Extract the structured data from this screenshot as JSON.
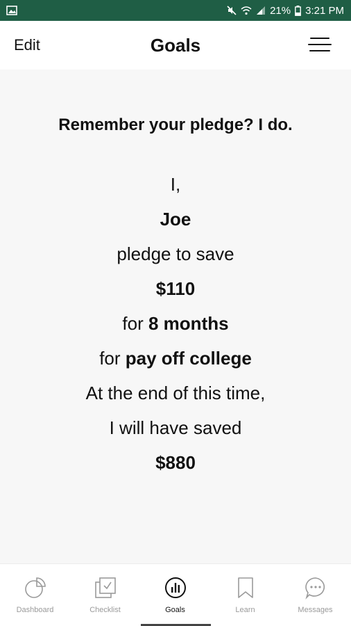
{
  "status_bar": {
    "battery": "21%",
    "time": "3:21 PM"
  },
  "header": {
    "edit_label": "Edit",
    "title": "Goals"
  },
  "pledge": {
    "headline": "Remember your pledge? I do.",
    "line_i": "I,",
    "name": "Joe",
    "line_pledge": "pledge to save",
    "amount": "$110",
    "for_prefix": "for",
    "duration": "8 months",
    "goal_prefix": "for",
    "goal": "pay off college",
    "line_end": "At the end of this time,",
    "line_saved": "I will have saved",
    "total": "$880"
  },
  "nav": {
    "items": [
      {
        "label": "Dashboard",
        "icon": "pie-chart-icon"
      },
      {
        "label": "Checklist",
        "icon": "checklist-icon"
      },
      {
        "label": "Goals",
        "icon": "bar-chart-circle-icon",
        "active": true
      },
      {
        "label": "Learn",
        "icon": "bookmark-icon"
      },
      {
        "label": "Messages",
        "icon": "chat-bubble-icon"
      }
    ]
  }
}
